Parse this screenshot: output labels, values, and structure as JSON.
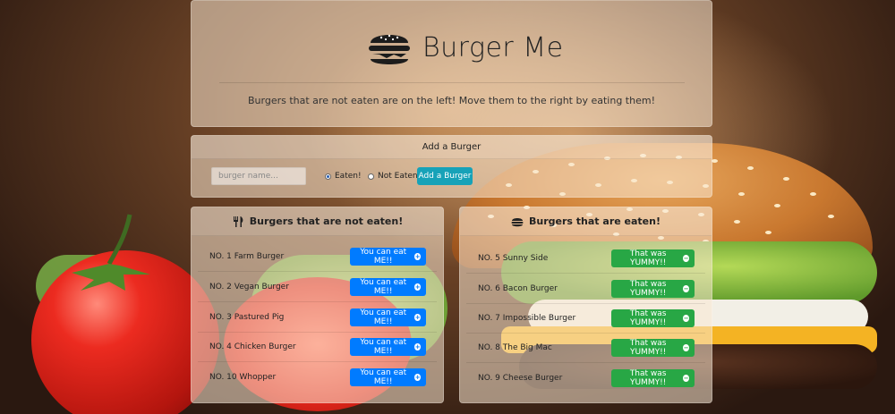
{
  "header": {
    "title": "Burger Me",
    "tagline": "Burgers that are not eaten are on the left! Move them to the right by eating them!"
  },
  "add_form": {
    "heading": "Add a Burger",
    "input_placeholder": "burger name...",
    "input_value": "",
    "radio_eaten_label": "Eaten!",
    "radio_not_eaten_label": "Not Eaten",
    "selected": "Eaten!",
    "submit_label": "Add a Burger"
  },
  "not_eaten": {
    "heading": "Burgers that are not eaten!",
    "icon": "utensils-icon",
    "button_label": "You can eat ME!!",
    "items": [
      {
        "label": "NO. 1 Farm Burger"
      },
      {
        "label": "NO. 2 Vegan Burger"
      },
      {
        "label": "NO. 3 Pastured Pig"
      },
      {
        "label": "NO. 4 Chicken Burger"
      },
      {
        "label": "NO. 10 Whopper"
      }
    ]
  },
  "eaten": {
    "heading": "Burgers that are eaten!",
    "icon": "hamburger-icon",
    "button_label": "That was YUMMY!!",
    "items": [
      {
        "label": "NO. 5 Sunny Side"
      },
      {
        "label": "NO. 6 Bacon Burger"
      },
      {
        "label": "NO. 7 Impossible Burger"
      },
      {
        "label": "NO. 8 The Big Mac"
      },
      {
        "label": "NO. 9 Cheese Burger"
      }
    ]
  },
  "colors": {
    "primary_button": "#007bff",
    "success_button": "#28a745",
    "info_button": "#17a2b8"
  }
}
